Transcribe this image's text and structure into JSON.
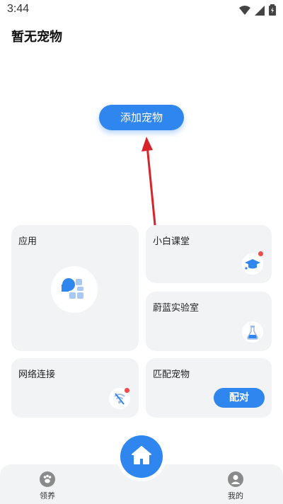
{
  "status_bar": {
    "time": "3:44"
  },
  "header": {
    "title": "暂无宠物"
  },
  "main": {
    "add_pet_label": "添加宠物"
  },
  "cards": {
    "apps": {
      "label": "应用"
    },
    "classroom": {
      "label": "小白课堂"
    },
    "lab": {
      "label": "蔚蓝实验室"
    },
    "network": {
      "label": "网络连接"
    },
    "match": {
      "label": "匹配宠物",
      "button_label": "配对"
    }
  },
  "bottom_nav": {
    "items": [
      {
        "label": "领养",
        "icon": "paw-icon"
      },
      {
        "label": "我的",
        "icon": "user-icon"
      }
    ],
    "center_icon": "home-icon"
  },
  "colors": {
    "accent": "#2f86ef",
    "card_bg": "#f2f3f5",
    "arrow": "#d9232a",
    "badge": "#ef4b4b"
  }
}
